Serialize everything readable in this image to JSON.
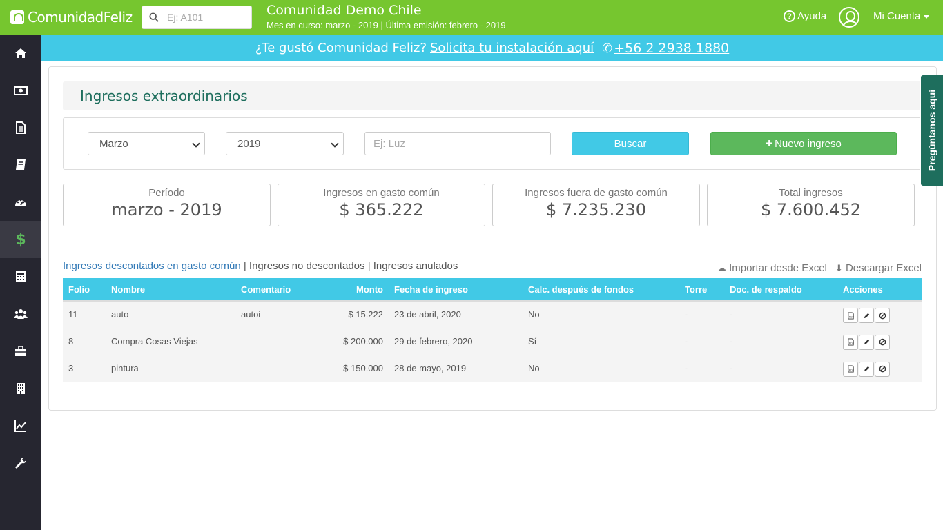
{
  "app": {
    "brand": "ComunidadFeliz",
    "search_placeholder": "Ej: A101",
    "community_name": "Comunidad Demo Chile",
    "community_sub": "Mes en curso: marzo - 2019 | Última emisión: febrero - 2019",
    "help_label": "Ayuda",
    "account_label": "Mi Cuenta"
  },
  "banner": {
    "text": "¿Te gustó Comunidad Feliz?",
    "link": "Solicita tu instalación aquí",
    "phone": "+56 2 2938 1880"
  },
  "page": {
    "title": "Ingresos extraordinarios",
    "ask_tab": "Pregúntanos aquí"
  },
  "filters": {
    "month": "Marzo",
    "year": "2019",
    "text_placeholder": "Ej: Luz",
    "search_label": "Buscar",
    "new_label": "Nuevo ingreso"
  },
  "stats": [
    {
      "label": "Período",
      "value": "marzo - 2019"
    },
    {
      "label": "Ingresos en gasto común",
      "value": "$ 365.222"
    },
    {
      "label": "Ingresos fuera de gasto común",
      "value": "$ 7.235.230"
    },
    {
      "label": "Total ingresos",
      "value": "$ 7.600.452"
    }
  ],
  "tabs": {
    "active": "Ingresos descontados en gasto común",
    "sep": " | ",
    "second": "Ingresos no descontados",
    "third": "Ingresos anulados"
  },
  "excel": {
    "import": "Importar desde Excel",
    "download": "Descargar Excel"
  },
  "table": {
    "headers": [
      "Folio",
      "Nombre",
      "Comentario",
      "Monto",
      "Fecha de ingreso",
      "Calc. después de fondos",
      "Torre",
      "Doc. de respaldo",
      "Acciones"
    ],
    "rows": [
      {
        "folio": "11",
        "nombre": "auto",
        "comentario": "autoi",
        "monto": "$ 15.222",
        "fecha": "23 de abril, 2020",
        "calc": "No",
        "torre": "-",
        "doc": "-"
      },
      {
        "folio": "8",
        "nombre": "Compra Cosas Viejas",
        "comentario": "",
        "monto": "$ 200.000",
        "fecha": "29 de febrero, 2020",
        "calc": "Sí",
        "torre": "-",
        "doc": "-"
      },
      {
        "folio": "3",
        "nombre": "pintura",
        "comentario": "",
        "monto": "$ 150.000",
        "fecha": "28 de mayo, 2019",
        "calc": "No",
        "torre": "-",
        "doc": "-"
      }
    ]
  },
  "sidebar": {
    "items": [
      "home-icon",
      "money-icon",
      "document-icon",
      "book-icon",
      "dashboard-icon",
      "dollar-icon",
      "calculator-icon",
      "users-icon",
      "briefcase-icon",
      "building-icon",
      "chart-icon",
      "wrench-icon"
    ],
    "active_index": 5
  },
  "colors": {
    "topbar": "#76c62f",
    "banner": "#41c9e6",
    "sidebar": "#262630",
    "primary_green": "#5cb85c",
    "title_green": "#1e6e5d"
  }
}
